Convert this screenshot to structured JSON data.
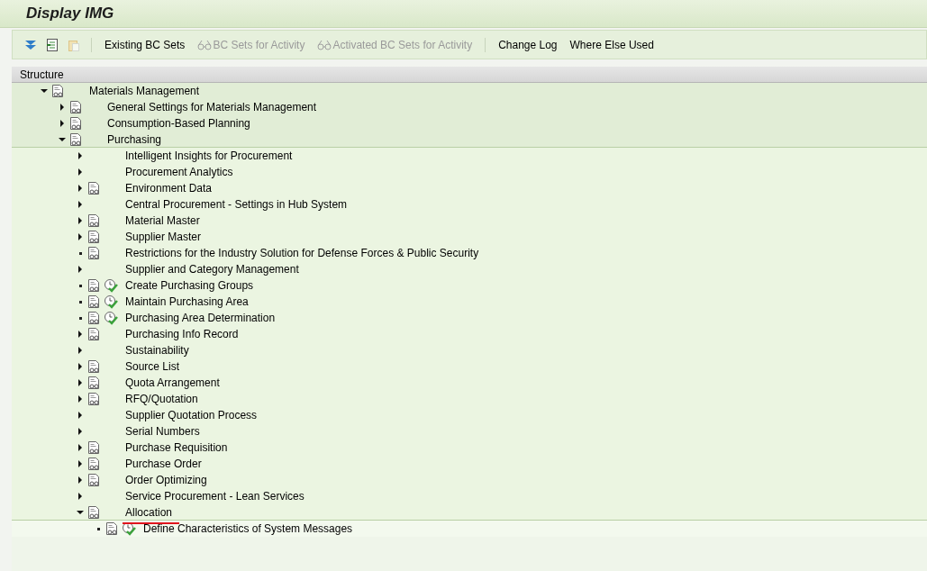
{
  "window": {
    "title": "Display IMG"
  },
  "toolbar": [
    {
      "kind": "expand",
      "disabled": false
    },
    {
      "kind": "import",
      "disabled": false
    },
    {
      "kind": "clipboard",
      "disabled": true
    },
    {
      "kind": "separator"
    },
    {
      "kind": "text",
      "label": "Existing BC Sets",
      "disabled": false
    },
    {
      "kind": "bcset",
      "label": "BC Sets for Activity",
      "disabled": true
    },
    {
      "kind": "bcset",
      "label": "Activated BC Sets for Activity",
      "disabled": true
    },
    {
      "kind": "separator"
    },
    {
      "kind": "text",
      "label": "Change Log",
      "disabled": false
    },
    {
      "kind": "text",
      "label": "Where Else Used",
      "disabled": false
    }
  ],
  "tree": {
    "header": "Structure",
    "nodes": [
      {
        "label": "Materials Management",
        "kind": "expandable",
        "expanded": true,
        "document": true,
        "activity": false,
        "children": [
          {
            "label": "General Settings for Materials Management",
            "kind": "expandable",
            "expanded": false,
            "document": true,
            "activity": false
          },
          {
            "label": "Consumption-Based Planning",
            "kind": "expandable",
            "expanded": false,
            "document": true,
            "activity": false
          },
          {
            "label": "Purchasing",
            "kind": "expandable",
            "expanded": true,
            "document": true,
            "activity": false,
            "children": [
              {
                "label": "Intelligent Insights for Procurement",
                "kind": "expandable",
                "expanded": false,
                "document": false,
                "activity": false
              },
              {
                "label": "Procurement Analytics",
                "kind": "expandable",
                "expanded": false,
                "document": false,
                "activity": false
              },
              {
                "label": "Environment Data",
                "kind": "expandable",
                "expanded": false,
                "document": true,
                "activity": false
              },
              {
                "label": "Central Procurement - Settings in Hub System",
                "kind": "expandable",
                "expanded": false,
                "document": false,
                "activity": false
              },
              {
                "label": "Material Master",
                "kind": "expandable",
                "expanded": false,
                "document": true,
                "activity": false
              },
              {
                "label": "Supplier Master",
                "kind": "expandable",
                "expanded": false,
                "document": true,
                "activity": false
              },
              {
                "label": "Restrictions for the Industry Solution for Defense Forces & Public Security",
                "kind": "leaf",
                "document": true,
                "activity": false
              },
              {
                "label": "Supplier and Category Management",
                "kind": "expandable",
                "expanded": false,
                "document": false,
                "activity": false
              },
              {
                "label": "Create Purchasing Groups",
                "kind": "leaf",
                "document": true,
                "activity": true
              },
              {
                "label": "Maintain Purchasing Area",
                "kind": "leaf",
                "document": true,
                "activity": true
              },
              {
                "label": "Purchasing Area Determination",
                "kind": "leaf",
                "document": true,
                "activity": true
              },
              {
                "label": "Purchasing Info Record",
                "kind": "expandable",
                "expanded": false,
                "document": true,
                "activity": false
              },
              {
                "label": "Sustainability",
                "kind": "expandable",
                "expanded": false,
                "document": false,
                "activity": false
              },
              {
                "label": "Source List",
                "kind": "expandable",
                "expanded": false,
                "document": true,
                "activity": false
              },
              {
                "label": "Quota Arrangement",
                "kind": "expandable",
                "expanded": false,
                "document": true,
                "activity": false
              },
              {
                "label": "RFQ/Quotation",
                "kind": "expandable",
                "expanded": false,
                "document": true,
                "activity": false
              },
              {
                "label": "Supplier Quotation Process",
                "kind": "expandable",
                "expanded": false,
                "document": false,
                "activity": false
              },
              {
                "label": "Serial Numbers",
                "kind": "expandable",
                "expanded": false,
                "document": false,
                "activity": false
              },
              {
                "label": "Purchase Requisition",
                "kind": "expandable",
                "expanded": false,
                "document": true,
                "activity": false
              },
              {
                "label": "Purchase Order",
                "kind": "expandable",
                "expanded": false,
                "document": true,
                "activity": false
              },
              {
                "label": "Order Optimizing",
                "kind": "expandable",
                "expanded": false,
                "document": true,
                "activity": false
              },
              {
                "label": "Service Procurement - Lean Services",
                "kind": "expandable",
                "expanded": false,
                "document": false,
                "activity": false
              },
              {
                "label": "Allocation",
                "kind": "expandable",
                "expanded": true,
                "document": true,
                "activity": false,
                "underlined": true,
                "children": [
                  {
                    "label": "Define Characteristics of System Messages",
                    "kind": "leaf",
                    "document": true,
                    "activity": true
                  }
                ]
              }
            ]
          }
        ]
      }
    ]
  }
}
